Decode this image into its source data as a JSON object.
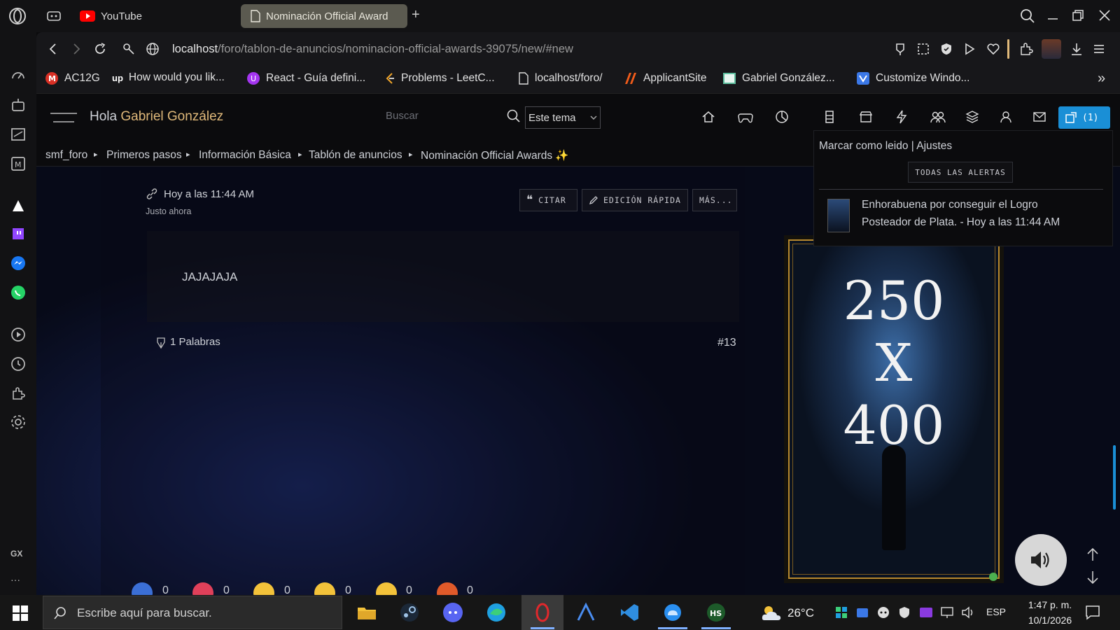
{
  "browser": {
    "tabs": [
      {
        "label": "YouTube"
      },
      {
        "label": "Nominación Official Award"
      }
    ],
    "new_tab": "+",
    "url_host": "localhost",
    "url_path": "/foro/tablon-de-anuncios/nominacion-official-awards-39075/new/#new",
    "bookmarks": [
      "AC12G",
      "How would you lik...",
      "React - Guía defini...",
      "Problems - LeetC...",
      "localhost/foro/",
      "ApplicantSite",
      "Gabriel González...",
      "Customize Windo..."
    ],
    "more_bookmarks": "»"
  },
  "forum": {
    "greeting_prefix": "Hola ",
    "user_name": "Gabriel González",
    "search_placeholder": "Buscar",
    "scope_select": "Este tema",
    "alerts_count": "(1)",
    "breadcrumb": [
      "smf_foro",
      "Primeros pasos",
      "Información Básica",
      "Tablón de anuncios",
      "Nominación Official Awards ✨"
    ],
    "crumb_sep": "▸"
  },
  "post": {
    "time": "Hoy a las 11:44 AM",
    "ago": "Justo ahora",
    "quote_btn": "CITAR",
    "quick_edit_btn": "EDICIÓN RÁPIDA",
    "more_btn": "MÁS...",
    "body": "JAJAJAJA",
    "words": "1 Palabras",
    "number": "#13",
    "reactions": [
      {
        "icon": "like",
        "count": "0",
        "color": "#3b6fd6"
      },
      {
        "icon": "love",
        "count": "0",
        "color": "#e0405a"
      },
      {
        "icon": "haha",
        "count": "0",
        "color": "#f3c23a"
      },
      {
        "icon": "wow",
        "count": "0",
        "color": "#f3c23a"
      },
      {
        "icon": "sad",
        "count": "0",
        "color": "#f3c23a"
      },
      {
        "icon": "angry",
        "count": "0",
        "color": "#e05a2a"
      }
    ]
  },
  "alerts": {
    "links": "Marcar como leido | Ajustes",
    "all_button": "TODAS LAS ALERTAS",
    "item_line1": "Enhorabuena por conseguir el Logro",
    "item_line2": "Posteador de Plata. - Hoy a las 11:44 AM"
  },
  "ad": {
    "line1": "250",
    "line2": "X",
    "line3": "400"
  },
  "sidebar": {
    "gx_label": "GX",
    "more": "···"
  },
  "taskbar": {
    "search_placeholder": "Escribe aquí para buscar.",
    "temperature": "26°C",
    "language": "ESP",
    "time": "1:47 p. m.",
    "date": "10/1/2026"
  },
  "colors": {
    "accent_name": "#e0b97a",
    "alert_button": "#1a8fd6",
    "opera_red": "#e0282c"
  }
}
